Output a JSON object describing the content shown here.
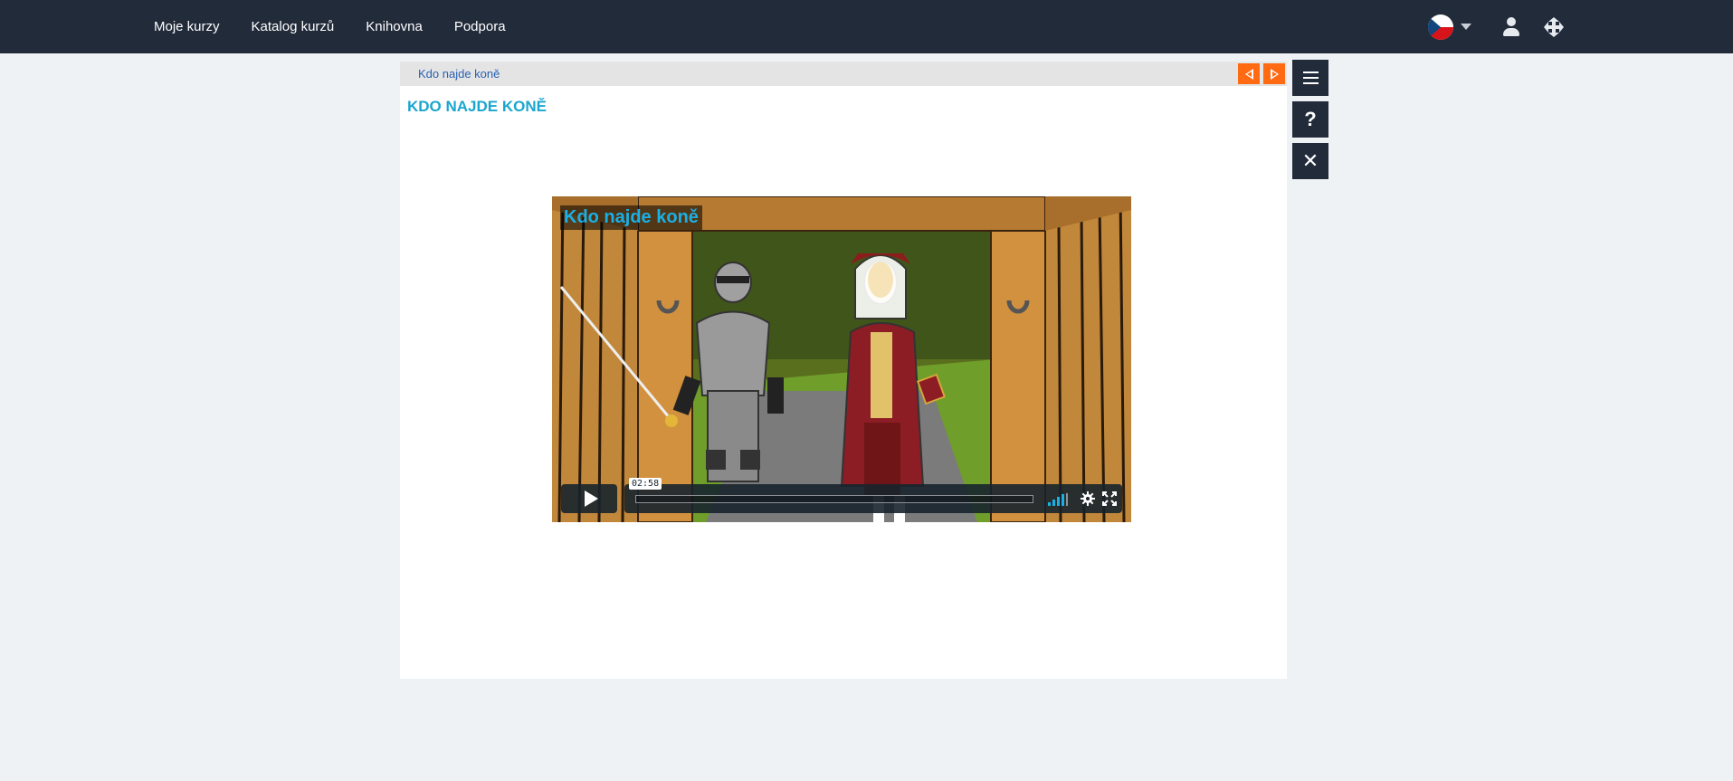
{
  "nav": {
    "items": [
      {
        "label": "Moje kurzy"
      },
      {
        "label": "Katalog kurzů"
      },
      {
        "label": "Knihovna"
      },
      {
        "label": "Podpora"
      }
    ],
    "language_icon": "czech-flag-icon",
    "user_icon": "user-icon",
    "move_icon": "move-arrows-icon"
  },
  "breadcrumb": {
    "label": "Kdo najde koně"
  },
  "lesson": {
    "title": "KDO NAJDE KONĚ"
  },
  "video": {
    "title": "Kdo najde koně",
    "time": "02:58"
  },
  "side_toolbar": {
    "help_label": "?",
    "close_label": "✕"
  },
  "colors": {
    "topbar": "#222b3a",
    "accent_orange": "#ff6a13",
    "title_blue": "#1ba6cf",
    "link_blue": "#2a62b3"
  }
}
